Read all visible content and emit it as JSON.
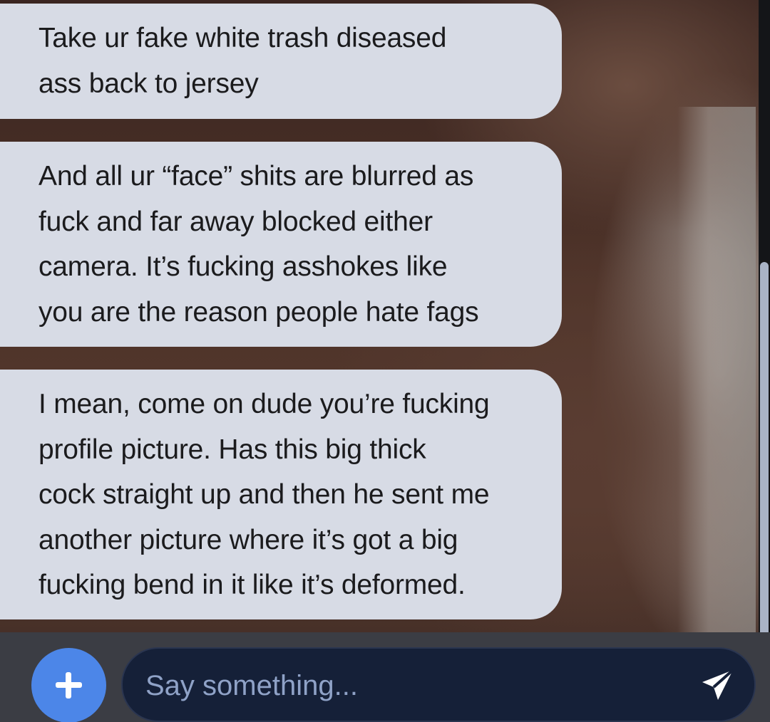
{
  "messages": [
    {
      "lines": [
        "Take ur fake white trash diseased",
        "ass back to jersey"
      ]
    },
    {
      "lines": [
        "And all ur “face” shits are blurred as",
        "fuck and far away blocked either",
        "camera. It’s fucking asshokes like",
        "you are the reason people hate fags"
      ]
    },
    {
      "lines": [
        "I mean, come on dude you’re fucking",
        "profile picture. Has this big thick",
        "cock straight up and then he sent me",
        "another picture where it’s got a big",
        "fucking bend in it like it’s deformed."
      ]
    }
  ],
  "composer": {
    "placeholder": "Say something...",
    "add_icon": "plus-icon",
    "send_icon": "send-paper-plane-icon"
  },
  "colors": {
    "bubble": "#d7dbe5",
    "accent": "#4c86e8",
    "input_background": "#152038"
  }
}
